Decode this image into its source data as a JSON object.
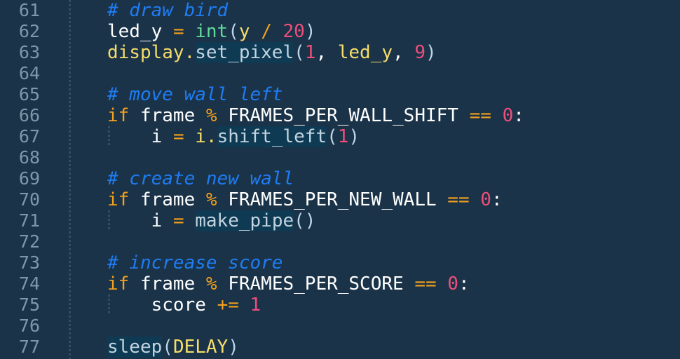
{
  "editor": {
    "theme_background": "#1a3348",
    "gutter_text_color": "#7d98ab",
    "highlight_background": "#0e3a53",
    "language": "python",
    "first_line_number": 61,
    "last_line_number": 77,
    "colors": {
      "comment": "#1f7cf2",
      "keyword": "#f5a11b",
      "operator": "#f5a11b",
      "number": "#ef4e7b",
      "builtin": "#62d99a",
      "identifier": "#ffffff",
      "object": "#f5dd6a",
      "constant": "#f5dd6a",
      "paren": "#b9d6ea",
      "method": "#c3d3df"
    }
  },
  "lines": [
    {
      "number": "61",
      "indent_guides": 0,
      "text": "# draw bird",
      "tokens": [
        {
          "cls": "t-comment",
          "text": "# draw bird"
        }
      ]
    },
    {
      "number": "62",
      "indent_guides": 0,
      "text": "led_y = int(y / 20)",
      "tokens": [
        {
          "cls": "t-var",
          "text": "led_y"
        },
        {
          "cls": "t-plain",
          "text": " "
        },
        {
          "cls": "t-op",
          "text": "="
        },
        {
          "cls": "t-plain",
          "text": " "
        },
        {
          "cls": "t-builtin",
          "text": "int"
        },
        {
          "cls": "t-paren",
          "text": "("
        },
        {
          "cls": "t-obj",
          "text": "y"
        },
        {
          "cls": "t-plain",
          "text": " "
        },
        {
          "cls": "t-op",
          "text": "/"
        },
        {
          "cls": "t-plain",
          "text": " "
        },
        {
          "cls": "t-num",
          "text": "20"
        },
        {
          "cls": "t-paren",
          "text": ")"
        }
      ]
    },
    {
      "number": "63",
      "indent_guides": 0,
      "text": "display.set_pixel(1, led_y, 9)",
      "tokens": [
        {
          "cls": "t-obj",
          "text": "display"
        },
        {
          "cls": "t-obj",
          "text": "."
        },
        {
          "cls": "t-method",
          "text": "set_pixel"
        },
        {
          "cls": "t-paren",
          "text": "("
        },
        {
          "cls": "t-num",
          "text": "1"
        },
        {
          "cls": "t-plain",
          "text": ", "
        },
        {
          "cls": "t-obj",
          "text": "led_y"
        },
        {
          "cls": "t-plain",
          "text": ", "
        },
        {
          "cls": "t-num",
          "text": "9"
        },
        {
          "cls": "t-paren",
          "text": ")"
        }
      ]
    },
    {
      "number": "64",
      "indent_guides": 0,
      "text": "",
      "tokens": []
    },
    {
      "number": "65",
      "indent_guides": 0,
      "text": "# move wall left",
      "tokens": [
        {
          "cls": "t-comment",
          "text": "# move wall left"
        }
      ]
    },
    {
      "number": "66",
      "indent_guides": 0,
      "text": "if frame % FRAMES_PER_WALL_SHIFT == 0:",
      "tokens": [
        {
          "cls": "t-kw",
          "text": "if"
        },
        {
          "cls": "t-plain",
          "text": " "
        },
        {
          "cls": "t-var",
          "text": "frame"
        },
        {
          "cls": "t-plain",
          "text": " "
        },
        {
          "cls": "t-op",
          "text": "%"
        },
        {
          "cls": "t-plain",
          "text": " "
        },
        {
          "cls": "t-const",
          "text": "FRAMES_PER_WALL_SHIFT"
        },
        {
          "cls": "t-plain",
          "text": " "
        },
        {
          "cls": "t-op",
          "text": "=="
        },
        {
          "cls": "t-plain",
          "text": " "
        },
        {
          "cls": "t-num",
          "text": "0"
        },
        {
          "cls": "t-plain",
          "text": ":"
        }
      ]
    },
    {
      "number": "67",
      "indent_guides": 1,
      "text": "    i = i.shift_left(1)",
      "tokens": [
        {
          "cls": "t-plain",
          "text": "    "
        },
        {
          "cls": "t-var",
          "text": "i"
        },
        {
          "cls": "t-plain",
          "text": " "
        },
        {
          "cls": "t-op",
          "text": "="
        },
        {
          "cls": "t-plain",
          "text": " "
        },
        {
          "cls": "t-obj",
          "text": "i"
        },
        {
          "cls": "t-obj",
          "text": "."
        },
        {
          "cls": "t-method",
          "text": "shift_left"
        },
        {
          "cls": "t-paren",
          "text": "("
        },
        {
          "cls": "t-num",
          "text": "1"
        },
        {
          "cls": "t-paren",
          "text": ")"
        }
      ]
    },
    {
      "number": "68",
      "indent_guides": 0,
      "text": "",
      "tokens": []
    },
    {
      "number": "69",
      "indent_guides": 0,
      "text": "# create new wall",
      "tokens": [
        {
          "cls": "t-comment",
          "text": "# create new wall"
        }
      ]
    },
    {
      "number": "70",
      "indent_guides": 0,
      "text": "if frame % FRAMES_PER_NEW_WALL == 0:",
      "tokens": [
        {
          "cls": "t-kw",
          "text": "if"
        },
        {
          "cls": "t-plain",
          "text": " "
        },
        {
          "cls": "t-var",
          "text": "frame"
        },
        {
          "cls": "t-plain",
          "text": " "
        },
        {
          "cls": "t-op",
          "text": "%"
        },
        {
          "cls": "t-plain",
          "text": " "
        },
        {
          "cls": "t-const",
          "text": "FRAMES_PER_NEW_WALL"
        },
        {
          "cls": "t-plain",
          "text": " "
        },
        {
          "cls": "t-op",
          "text": "=="
        },
        {
          "cls": "t-plain",
          "text": " "
        },
        {
          "cls": "t-num",
          "text": "0"
        },
        {
          "cls": "t-plain",
          "text": ":"
        }
      ]
    },
    {
      "number": "71",
      "indent_guides": 1,
      "text": "    i = make_pipe()",
      "tokens": [
        {
          "cls": "t-plain",
          "text": "    "
        },
        {
          "cls": "t-var",
          "text": "i"
        },
        {
          "cls": "t-plain",
          "text": " "
        },
        {
          "cls": "t-op",
          "text": "="
        },
        {
          "cls": "t-plain",
          "text": " "
        },
        {
          "cls": "t-method",
          "text": "make_pipe"
        },
        {
          "cls": "t-paren",
          "text": "()"
        }
      ]
    },
    {
      "number": "72",
      "indent_guides": 0,
      "text": "",
      "tokens": []
    },
    {
      "number": "73",
      "indent_guides": 0,
      "text": "# increase score",
      "tokens": [
        {
          "cls": "t-comment",
          "text": "# increase score"
        }
      ]
    },
    {
      "number": "74",
      "indent_guides": 0,
      "text": "if frame % FRAMES_PER_SCORE == 0:",
      "tokens": [
        {
          "cls": "t-kw",
          "text": "if"
        },
        {
          "cls": "t-plain",
          "text": " "
        },
        {
          "cls": "t-var",
          "text": "frame"
        },
        {
          "cls": "t-plain",
          "text": " "
        },
        {
          "cls": "t-op",
          "text": "%"
        },
        {
          "cls": "t-plain",
          "text": " "
        },
        {
          "cls": "t-const",
          "text": "FRAMES_PER_SCORE"
        },
        {
          "cls": "t-plain",
          "text": " "
        },
        {
          "cls": "t-op",
          "text": "=="
        },
        {
          "cls": "t-plain",
          "text": " "
        },
        {
          "cls": "t-num",
          "text": "0"
        },
        {
          "cls": "t-plain",
          "text": ":"
        }
      ]
    },
    {
      "number": "75",
      "indent_guides": 1,
      "text": "    score += 1",
      "tokens": [
        {
          "cls": "t-plain",
          "text": "    "
        },
        {
          "cls": "t-var",
          "text": "score"
        },
        {
          "cls": "t-plain",
          "text": " "
        },
        {
          "cls": "t-op",
          "text": "+="
        },
        {
          "cls": "t-plain",
          "text": " "
        },
        {
          "cls": "t-num",
          "text": "1"
        }
      ]
    },
    {
      "number": "76",
      "indent_guides": 0,
      "text": "",
      "tokens": []
    },
    {
      "number": "77",
      "indent_guides": 0,
      "text": "sleep(DELAY)",
      "tokens": [
        {
          "cls": "t-method",
          "text": "sleep"
        },
        {
          "cls": "t-paren",
          "text": "("
        },
        {
          "cls": "t-yellow",
          "text": "DELAY"
        },
        {
          "cls": "t-paren",
          "text": ")"
        }
      ]
    }
  ]
}
